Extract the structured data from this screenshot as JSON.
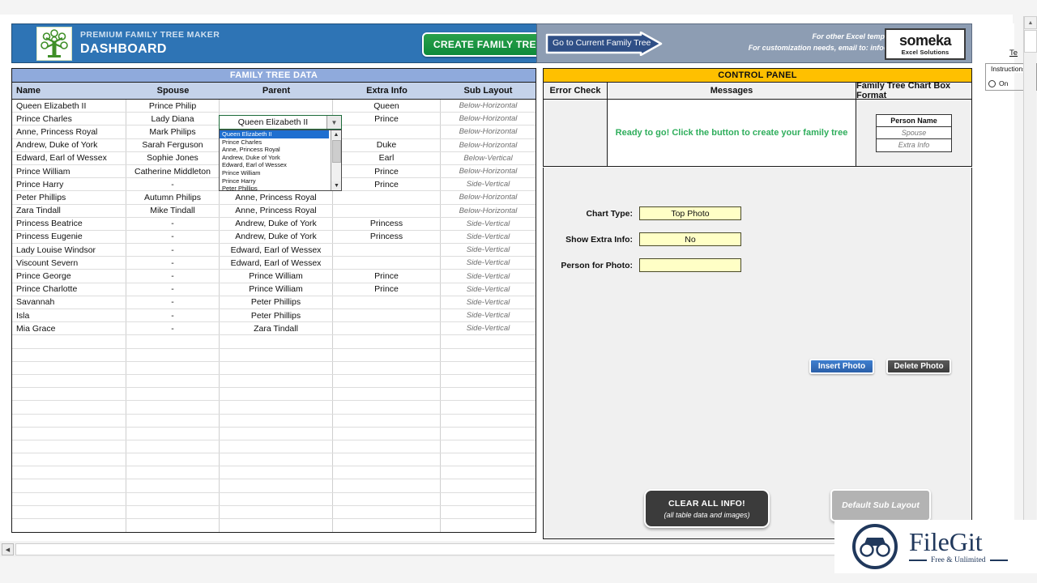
{
  "banner": {
    "subtitle": "PREMIUM FAMILY TREE MAKER",
    "title": "DASHBOARD",
    "create_button": "CREATE FAMILY TREE",
    "goto_button": "Go to Current Family Tree",
    "promo_line1": "For other Excel templates, click →",
    "promo_line2": "For customization needs, email to: info@someka.net",
    "brand_word": "someka",
    "brand_sub": "Excel Solutions",
    "logo_icon": "family-tree-icon"
  },
  "table": {
    "title": "FAMILY TREE DATA",
    "columns": [
      "Name",
      "Spouse",
      "Parent",
      "Extra Info",
      "Sub Layout"
    ],
    "rows": [
      [
        "Queen Elizabeth II",
        "Prince Philip",
        "",
        "Queen",
        "Below-Horizontal"
      ],
      [
        "Prince Charles",
        "Lady Diana",
        "Queen Elizabeth II",
        "Prince",
        "Below-Horizontal"
      ],
      [
        "Anne, Princess Royal",
        "Mark Philips",
        "",
        "",
        "Below-Horizontal"
      ],
      [
        "Andrew, Duke of York",
        "Sarah Ferguson",
        "",
        "Duke",
        "Below-Horizontal"
      ],
      [
        "Edward, Earl of Wessex",
        "Sophie Jones",
        "",
        "Earl",
        "Below-Vertical"
      ],
      [
        "Prince William",
        "Catherine Middleton",
        "",
        "Prince",
        "Below-Horizontal"
      ],
      [
        "Prince Harry",
        "-",
        "",
        "Prince",
        "Side-Vertical"
      ],
      [
        "Peter Phillips",
        "Autumn Philips",
        "Anne, Princess Royal",
        "",
        "Below-Horizontal"
      ],
      [
        "Zara Tindall",
        "Mike Tindall",
        "Anne, Princess Royal",
        "",
        "Below-Horizontal"
      ],
      [
        "Princess Beatrice",
        "-",
        "Andrew, Duke of York",
        "Princess",
        "Side-Vertical"
      ],
      [
        "Princess Eugenie",
        "-",
        "Andrew, Duke of York",
        "Princess",
        "Side-Vertical"
      ],
      [
        "Lady Louise Windsor",
        "-",
        "Edward, Earl of Wessex",
        "",
        "Side-Vertical"
      ],
      [
        "Viscount Severn",
        "-",
        "Edward, Earl of Wessex",
        "",
        "Side-Vertical"
      ],
      [
        "Prince George",
        "-",
        "Prince William",
        "Prince",
        "Side-Vertical"
      ],
      [
        "Prince Charlotte",
        "-",
        "Prince William",
        "Prince",
        "Side-Vertical"
      ],
      [
        "Savannah",
        "-",
        "Peter Phillips",
        "",
        "Side-Vertical"
      ],
      [
        "Isla",
        "-",
        "Peter Phillips",
        "",
        "Side-Vertical"
      ],
      [
        "Mia Grace",
        "-",
        "Zara Tindall",
        "",
        "Side-Vertical"
      ]
    ],
    "empty_rows": 15
  },
  "dropdown": {
    "selected_value": "Queen Elizabeth II",
    "options": [
      "Queen Elizabeth II",
      "Prince Charles",
      "Anne, Princess Royal",
      "Andrew, Duke of York",
      "Edward, Earl of Wessex",
      "Prince William",
      "Prince Harry",
      "Peter Phillips"
    ],
    "arrow_icon": "chevron-down-icon",
    "scroll_up_icon": "caret-up-icon",
    "scroll_down_icon": "caret-down-icon"
  },
  "control_panel": {
    "title": "CONTROL PANEL",
    "columns": [
      "Error Check",
      "Messages",
      "Family Tree Chart Box Format"
    ],
    "message": "Ready to go! Click the button to create your family tree",
    "box_format": {
      "person_name": "Person Name",
      "spouse": "Spouse",
      "extra_info": "Extra Info"
    },
    "chart_type_label": "Chart Type:",
    "chart_type_value": "Top Photo",
    "show_extra_label": "Show Extra Info:",
    "show_extra_value": "No",
    "person_photo_label": "Person for Photo:",
    "person_photo_value": "",
    "insert_photo_button": "Insert Photo",
    "delete_photo_button": "Delete Photo",
    "clear_button_line1": "CLEAR ALL INFO!",
    "clear_button_line2": "(all table data and images)",
    "sub_layout_button": "Default Sub Layout"
  },
  "right_panel": {
    "te_link": "Te",
    "instructions_legend": "Instructions",
    "on_label": "On"
  },
  "scrollbars": {
    "up_icon": "caret-up-icon",
    "left_icon": "caret-left-icon"
  },
  "watermark": {
    "name": "FileGit",
    "tagline": "Free & Unlimited",
    "logo_icon": "filegit-binoculars-icon"
  },
  "colors": {
    "banner_blue": "#2e74b5",
    "create_green": "#17913f",
    "panel_yellow": "#ffc000",
    "table_header_blue": "#8faadc",
    "ready_green": "#2fae5c",
    "input_yellow": "#ffffc6"
  }
}
